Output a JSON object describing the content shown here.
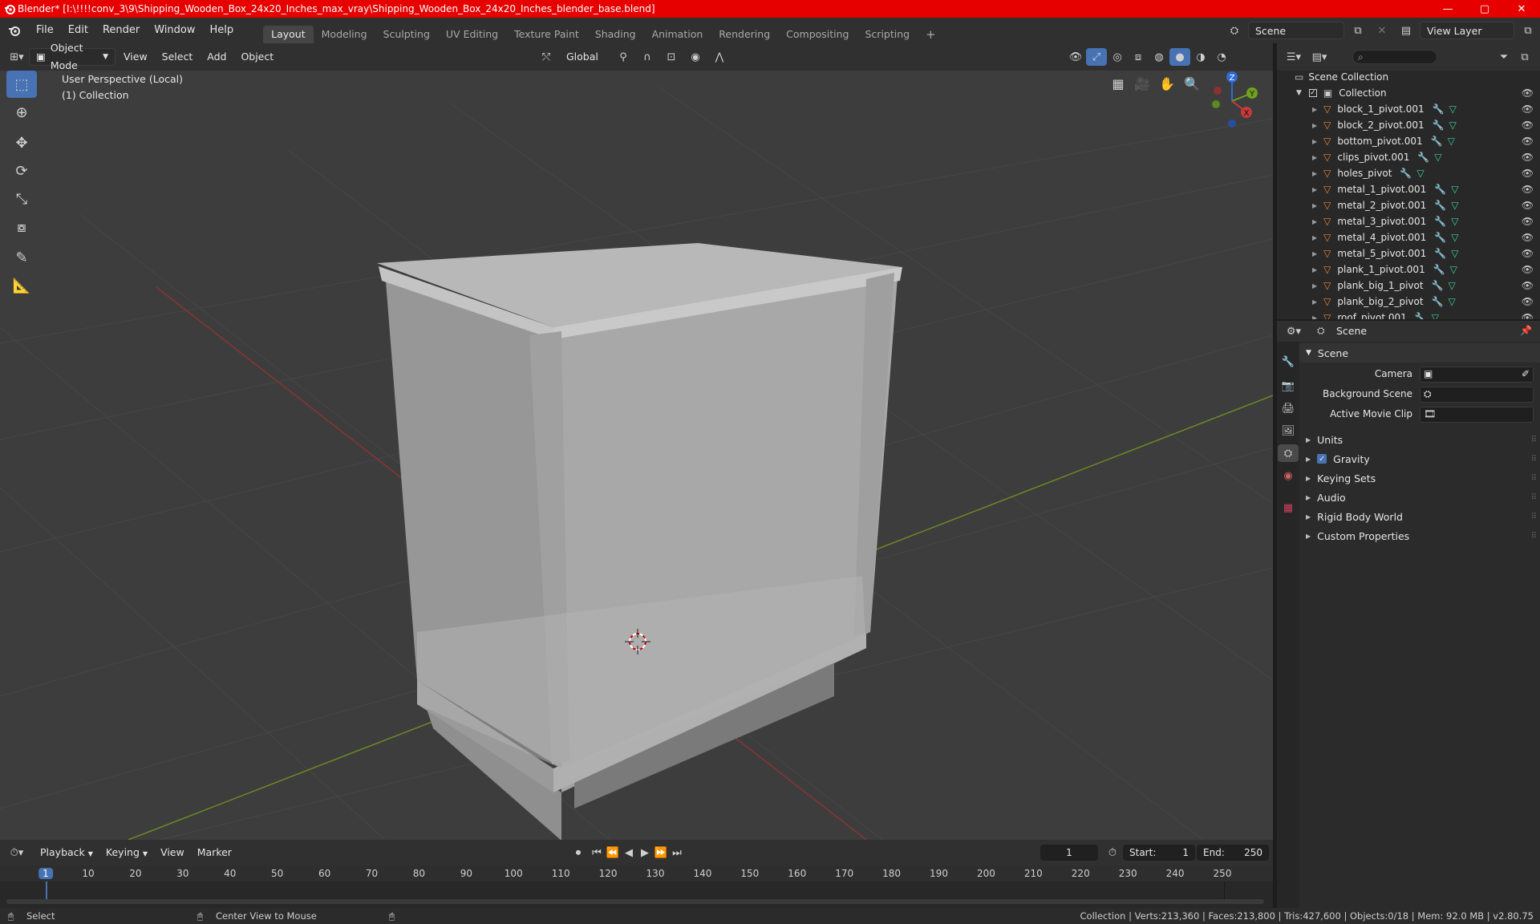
{
  "window": {
    "title": "Blender* [I:\\!!!!conv_3\\9\\Shipping_Wooden_Box_24x20_Inches_max_vray\\Shipping_Wooden_Box_24x20_Inches_blender_base.blend]",
    "minimize": "—",
    "maximize": "▢",
    "close": "✕"
  },
  "menu": [
    "File",
    "Edit",
    "Render",
    "Window",
    "Help"
  ],
  "workspaces": [
    "Layout",
    "Modeling",
    "Sculpting",
    "UV Editing",
    "Texture Paint",
    "Shading",
    "Animation",
    "Rendering",
    "Compositing",
    "Scripting"
  ],
  "add_workspace": "+",
  "scene_name": "Scene",
  "view_layer_name": "View Layer",
  "viewport_header": {
    "mode": "Object Mode",
    "menus": [
      "View",
      "Select",
      "Add",
      "Object"
    ],
    "transform_orientation": "Global"
  },
  "viewport": {
    "perspective": "User Perspective (Local)",
    "collection": "(1) Collection",
    "gizmo_axes": {
      "x": "X",
      "y": "Y",
      "z": "Z"
    }
  },
  "outliner": {
    "root": "Scene Collection",
    "collection": "Collection",
    "items": [
      {
        "name": "block_1_pivot.001",
        "mod": true
      },
      {
        "name": "block_2_pivot.001",
        "mod": true
      },
      {
        "name": "bottom_pivot.001",
        "mod": true
      },
      {
        "name": "clips_pivot.001",
        "mod": true
      },
      {
        "name": "holes_pivot",
        "mod": true
      },
      {
        "name": "metal_1_pivot.001",
        "mod": true
      },
      {
        "name": "metal_2_pivot.001",
        "mod": true
      },
      {
        "name": "metal_3_pivot.001",
        "mod": true
      },
      {
        "name": "metal_4_pivot.001",
        "mod": true
      },
      {
        "name": "metal_5_pivot.001",
        "mod": true
      },
      {
        "name": "plank_1_pivot.001",
        "mod": true
      },
      {
        "name": "plank_big_1_pivot",
        "mod": true
      },
      {
        "name": "plank_big_2_pivot",
        "mod": true
      },
      {
        "name": "roof_pivot.001",
        "mod": true
      }
    ]
  },
  "properties": {
    "context": "Scene",
    "section": "Scene",
    "camera_label": "Camera",
    "background_scene_label": "Background Scene",
    "active_movie_clip_label": "Active Movie Clip",
    "panels": [
      "Units",
      "Gravity",
      "Keying Sets",
      "Audio",
      "Rigid Body World",
      "Custom Properties"
    ],
    "gravity_checked": true
  },
  "timeline": {
    "menus": [
      "Playback",
      "Keying",
      "View",
      "Marker"
    ],
    "current_frame": "1",
    "start_label": "Start:",
    "start": "1",
    "end_label": "End:",
    "end": "250",
    "ticks": [
      "1",
      "10",
      "20",
      "30",
      "40",
      "50",
      "60",
      "70",
      "80",
      "90",
      "100",
      "110",
      "120",
      "130",
      "140",
      "150",
      "160",
      "170",
      "180",
      "190",
      "200",
      "210",
      "220",
      "230",
      "240",
      "250"
    ]
  },
  "status": {
    "select": "Select",
    "center": "Center View to Mouse",
    "stats": "Collection | Verts:213,360 | Faces:213,800 | Tris:427,600 | Objects:0/18 | Mem: 92.0 MB | v2.80.75"
  },
  "colors": {
    "titlebar": "#e60000",
    "accent": "#4772b3",
    "object_icon": "#e8883a",
    "mesh_icon": "#3fd0a0",
    "modifier_icon": "#6fa7ff"
  }
}
